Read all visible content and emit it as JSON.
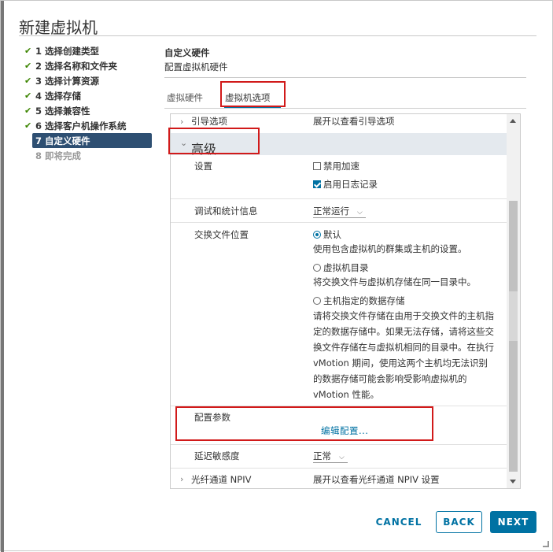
{
  "dialog": {
    "title": "新建虚拟机"
  },
  "steps": [
    {
      "label": "1 选择创建类型",
      "state": "done"
    },
    {
      "label": "2 选择名称和文件夹",
      "state": "done"
    },
    {
      "label": "3 选择计算资源",
      "state": "done"
    },
    {
      "label": "4 选择存储",
      "state": "done"
    },
    {
      "label": "5 选择兼容性",
      "state": "done"
    },
    {
      "label": "6 选择客户机操作系统",
      "state": "done"
    },
    {
      "label": "7 自定义硬件",
      "state": "active"
    },
    {
      "label": "8 即将完成",
      "state": "disabled"
    }
  ],
  "check_glyph": "✔",
  "header": {
    "title": "自定义硬件",
    "subtitle": "配置虚拟机硬件"
  },
  "tabs": [
    {
      "label": "虚拟硬件",
      "selected": false
    },
    {
      "label": "虚拟机选项",
      "selected": true
    }
  ],
  "panel": {
    "boot": {
      "label": "引导选项",
      "value": "展开以查看引导选项"
    },
    "advanced": {
      "label": "高级"
    },
    "settings": {
      "label": "设置",
      "disable_accel": {
        "label": "禁用加速",
        "checked": false
      },
      "enable_logging": {
        "label": "启用日志记录",
        "checked": true
      }
    },
    "debug": {
      "label": "调试和统计信息",
      "value": "正常运行"
    },
    "swap": {
      "label": "交换文件位置",
      "options": [
        {
          "label": "默认",
          "checked": true,
          "desc": "使用包含虚拟机的群集或主机的设置。"
        },
        {
          "label": "虚拟机目录",
          "checked": false,
          "desc": "将交换文件与虚拟机存储在同一目录中。"
        },
        {
          "label": "主机指定的数据存储",
          "checked": false,
          "desc": "请将交换文件存储在由用于交换文件的主机指定的数据存储中。如果无法存储，请将这些交换文件存储在与虚拟机相同的目录中。在执行 vMotion 期间，使用这两个主机均无法识别的数据存储可能会影响受影响虚拟机的 vMotion 性能。"
        }
      ]
    },
    "config": {
      "label": "配置参数",
      "link": "编辑配置..."
    },
    "latency": {
      "label": "延迟敏感度",
      "value": "正常"
    },
    "npiv": {
      "label": "光纤通道 NPIV",
      "value": "展开以查看光纤通道 NPIV 设置"
    }
  },
  "buttons": {
    "cancel": "CANCEL",
    "back": "BACK",
    "next": "NEXT"
  },
  "colors": {
    "accent": "#0072a3",
    "active_step": "#2e4f72",
    "highlight": "#d11a1a",
    "check": "#3c8500"
  }
}
